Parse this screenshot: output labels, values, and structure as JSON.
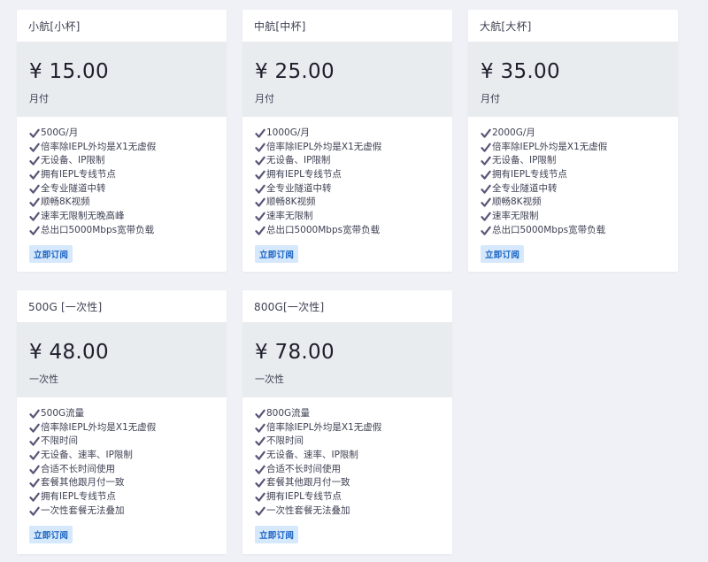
{
  "plans": [
    {
      "name": "小航[小杯]",
      "price": "¥ 15.00",
      "period": "月付",
      "features": [
        "500G/月",
        "倍率除IEPL外均是X1无虚假",
        "无设备、IP限制",
        "拥有IEPL专线节点",
        "全专业隧道中转",
        "顺畅8K视频",
        "速率无限制无晚高峰",
        "总出口5000Mbps宽带负载"
      ],
      "button": "立即订阅"
    },
    {
      "name": "中航[中杯]",
      "price": "¥ 25.00",
      "period": "月付",
      "features": [
        "1000G/月",
        "倍率除IEPL外均是X1无虚假",
        "无设备、IP限制",
        "拥有IEPL专线节点",
        "全专业隧道中转",
        "顺畅8K视频",
        "速率无限制",
        "总出口5000Mbps宽带负载"
      ],
      "button": "立即订阅"
    },
    {
      "name": "大航[大杯]",
      "price": "¥ 35.00",
      "period": "月付",
      "features": [
        "2000G/月",
        "倍率除IEPL外均是X1无虚假",
        "无设备、IP限制",
        "拥有IEPL专线节点",
        "全专业隧道中转",
        "顺畅8K视频",
        "速率无限制",
        "总出口5000Mbps宽带负载"
      ],
      "button": "立即订阅"
    },
    {
      "name": "500G [一次性]",
      "price": "¥ 48.00",
      "period": "一次性",
      "features": [
        "500G流量",
        "倍率除IEPL外均是X1无虚假",
        "不限时间",
        "无设备、速率、IP限制",
        "合适不长时间使用",
        "套餐其他跟月付一致",
        "拥有IEPL专线节点",
        "一次性套餐无法叠加"
      ],
      "button": "立即订阅"
    },
    {
      "name": "800G[一次性]",
      "price": "¥ 78.00",
      "period": "一次性",
      "features": [
        "800G流量",
        "倍率除IEPL外均是X1无虚假",
        "不限时间",
        "无设备、速率、IP限制",
        "合适不长时间使用",
        "套餐其他跟月付一致",
        "拥有IEPL专线节点",
        "一次性套餐无法叠加"
      ],
      "button": "立即订阅"
    }
  ],
  "colors": {
    "page_background": "#eff1f6",
    "price_block": "#e9ecef",
    "check_icon": "#5a5577",
    "button_background": "#d6e8fb",
    "button_text": "#1761c2"
  },
  "icons": {
    "feature_bullet": "check-icon"
  }
}
